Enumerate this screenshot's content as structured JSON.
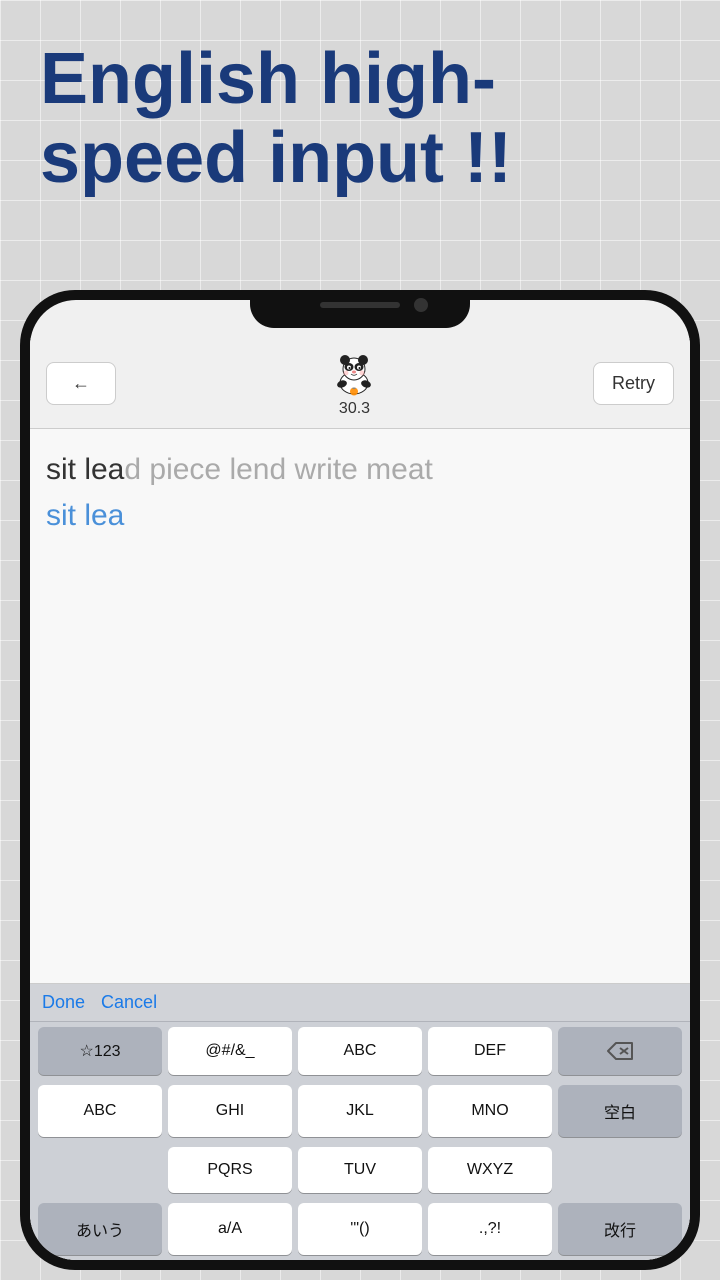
{
  "background": {
    "color": "#d8d8d8"
  },
  "header": {
    "title": "English high-speed input !!"
  },
  "phone": {
    "topbar": {
      "back_label": "←",
      "score": "30.3",
      "retry_label": "Retry"
    },
    "text_display": {
      "prompt_gray": "sit lea",
      "prompt_black": "d piece lend write meat",
      "input_blue": "sit lea",
      "input_gray": ""
    },
    "toolbar": {
      "done_label": "Done",
      "cancel_label": "Cancel"
    },
    "keyboard": {
      "rows": [
        [
          "☆123",
          "@#/&_",
          "ABC",
          "DEF",
          "⌫"
        ],
        [
          "ABC",
          "GHI",
          "JKL",
          "MNO",
          "空白"
        ],
        [
          "",
          "PQRS",
          "TUV",
          "WXYZ",
          ""
        ],
        [
          "あいう",
          "a/A",
          "'\"()",
          ".,?!",
          "改行"
        ]
      ]
    }
  }
}
